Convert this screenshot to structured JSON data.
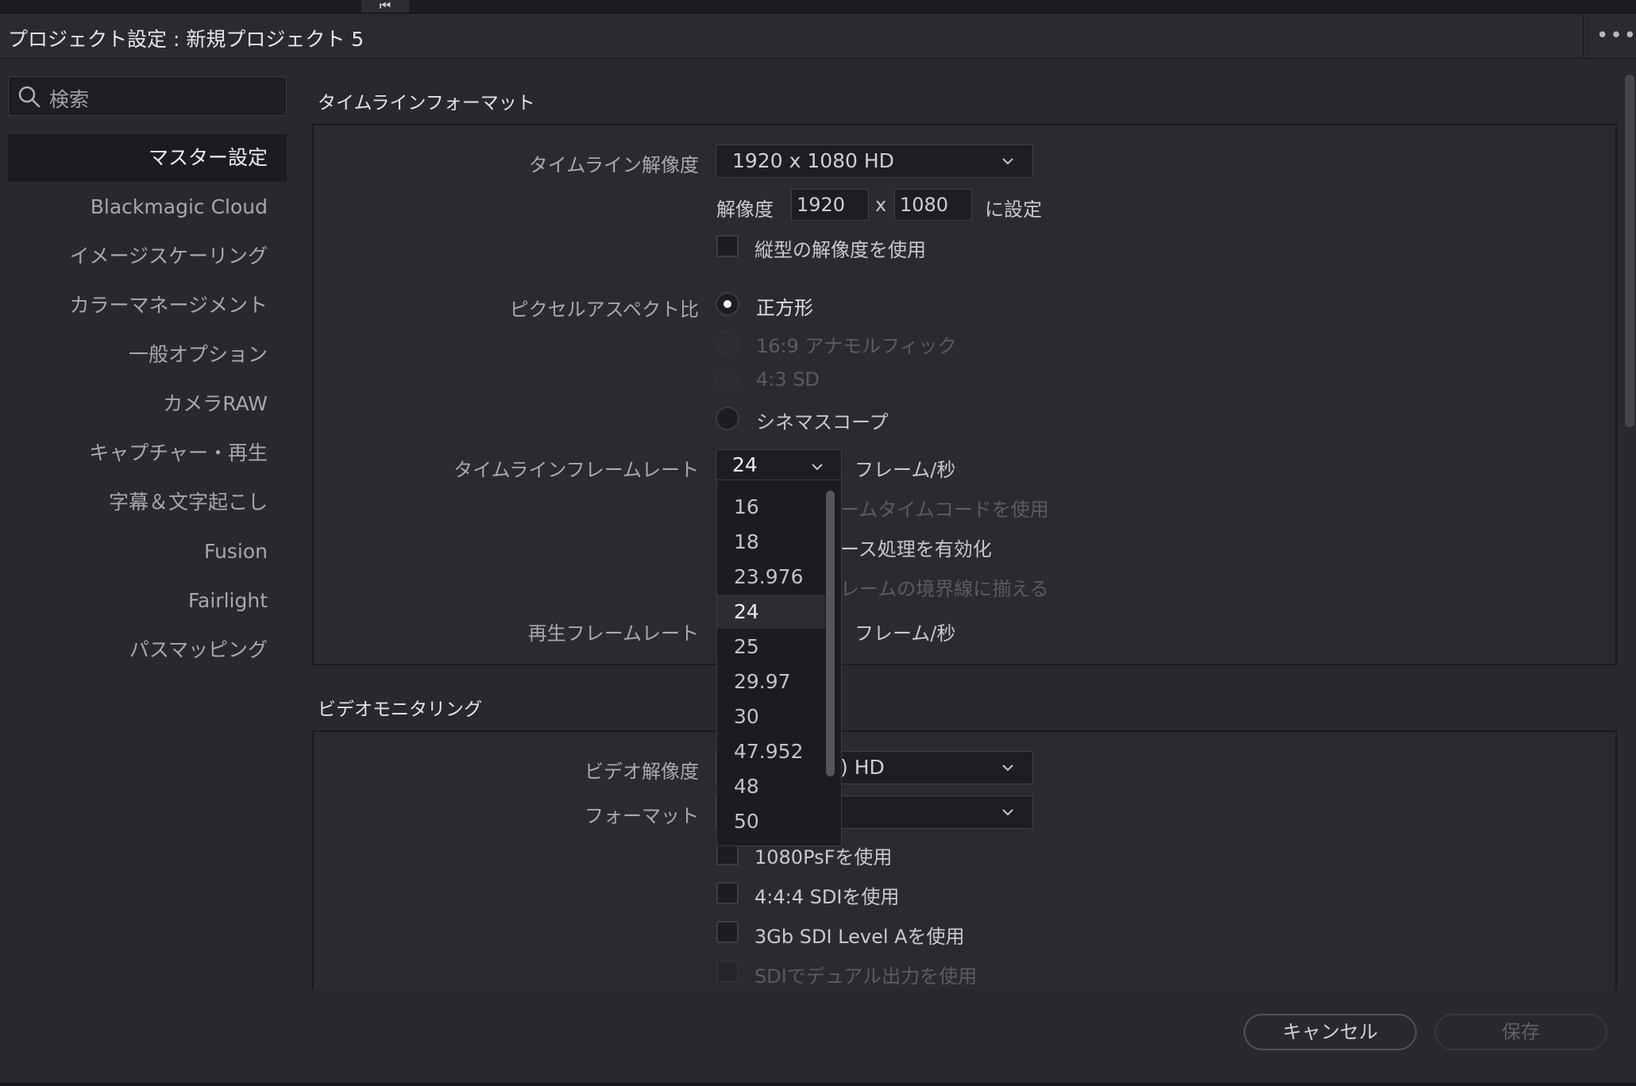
{
  "window": {
    "title": "プロジェクト設定 : 新規プロジェクト 5",
    "more_icon": "ellipsis-icon",
    "top_marker": "⏮"
  },
  "sidebar": {
    "search_placeholder": "検索",
    "items": [
      {
        "label": "マスター設定",
        "active": true
      },
      {
        "label": "Blackmagic Cloud"
      },
      {
        "label": "イメージスケーリング"
      },
      {
        "label": "カラーマネージメント"
      },
      {
        "label": "一般オプション"
      },
      {
        "label": "カメラRAW"
      },
      {
        "label": "キャプチャー・再生"
      },
      {
        "label": "字幕＆文字起こし"
      },
      {
        "label": "Fusion"
      },
      {
        "label": "Fairlight"
      },
      {
        "label": "パスマッピング"
      }
    ]
  },
  "timeline_format": {
    "section_title": "タイムラインフォーマット",
    "resolution_label": "タイムライン解像度",
    "resolution_value": "1920 x 1080 HD",
    "res_prefix": "解像度",
    "width": "1920",
    "x_sep": "x",
    "height": "1080",
    "res_suffix": "に設定",
    "vertical_label": "縦型の解像度を使用",
    "pixel_aspect_label": "ピクセルアスペクト比",
    "pixel_aspect_options": [
      {
        "label": "正方形",
        "selected": true,
        "enabled": true
      },
      {
        "label": "16:9 アナモルフィック",
        "selected": false,
        "enabled": false
      },
      {
        "label": "4:3 SD",
        "selected": false,
        "enabled": false
      },
      {
        "label": "シネマスコープ",
        "selected": false,
        "enabled": true
      }
    ],
    "framerate_label": "タイムラインフレームレート",
    "framerate_value": "24",
    "fps_unit": "フレーム/秒",
    "hidden_opt1_partial": "ームタイムコードを使用",
    "hidden_opt2_partial": "ース処理を有効化",
    "hidden_opt3_partial": "レームの境界線に揃える",
    "playback_label": "再生フレームレート",
    "playback_unit": "フレーム/秒"
  },
  "framerate_dropdown": {
    "options": [
      "16",
      "18",
      "23.976",
      "24",
      "25",
      "29.97",
      "30",
      "47.952",
      "48",
      "50"
    ],
    "selected": "24"
  },
  "video_monitoring": {
    "section_title": "ビデオモニタリング",
    "resolution_label": "ビデオ解像度",
    "resolution_partial": ") HD",
    "format_label": "フォーマット",
    "checkboxes": [
      {
        "label": "1080PsFを使用",
        "enabled": true
      },
      {
        "label": "4:4:4 SDIを使用",
        "enabled": true
      },
      {
        "label": "3Gb SDI Level Aを使用",
        "enabled": true
      },
      {
        "label": "SDIでデュアル出力を使用",
        "enabled": false
      }
    ]
  },
  "footer": {
    "cancel_label": "キャンセル",
    "save_label": "保存"
  }
}
